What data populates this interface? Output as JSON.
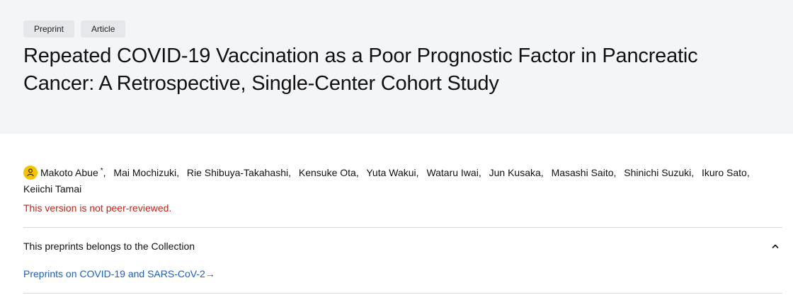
{
  "tags": [
    "Preprint",
    "Article"
  ],
  "title": "Repeated COVID-19 Vaccination as a Poor Prognostic Factor in Pancreatic Cancer: A Retrospective, Single-Center Cohort Study",
  "authors": [
    {
      "name": "Makoto Abue",
      "marker": "*"
    },
    {
      "name": "Mai Mochizuki"
    },
    {
      "name": "Rie Shibuya-Takahashi"
    },
    {
      "name": "Kensuke Ota"
    },
    {
      "name": "Yuta Wakui"
    },
    {
      "name": "Wataru Iwai"
    },
    {
      "name": "Jun Kusaka"
    },
    {
      "name": "Masashi Saito"
    },
    {
      "name": "Shinichi Suzuki"
    },
    {
      "name": "Ikuro Sato"
    },
    {
      "name": "Keiichi Tamai"
    }
  ],
  "review_notice": "This version is not peer-reviewed.",
  "collection": {
    "label": "This preprints belongs to the Collection",
    "link_text": "Preprints on COVID-19 and SARS-CoV-2",
    "arrow": "→"
  },
  "icons": {
    "corresponding_author": "user-icon",
    "collapse": "chevron-up-icon"
  },
  "colors": {
    "hero_bg": "#f4f5f7",
    "notice": "#c0261a",
    "link": "#1a5fc4",
    "avatar": "#f5c400"
  }
}
